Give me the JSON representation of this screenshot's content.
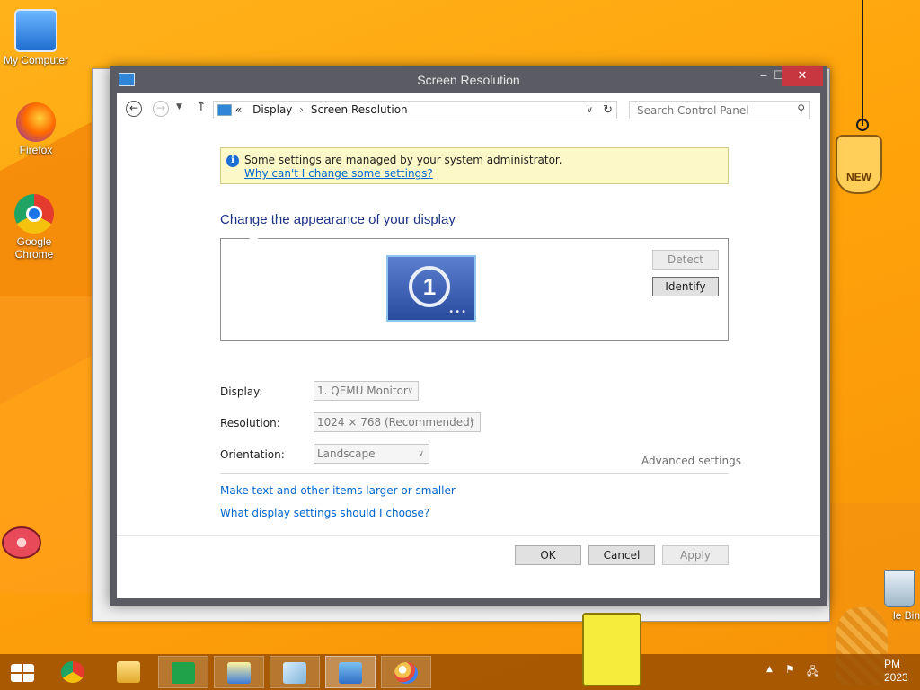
{
  "desktop": {
    "icons": [
      {
        "label": "My Computer"
      },
      {
        "label": "Firefox"
      },
      {
        "label": "Google Chrome"
      },
      {
        "label": "le Bin"
      }
    ],
    "tag_text": "NEW"
  },
  "window": {
    "title": "Screen Resolution",
    "address": {
      "prefix": "«",
      "crumbs": [
        "Display",
        "Screen Resolution"
      ],
      "separator": "›"
    },
    "search": {
      "placeholder": "Search Control Panel"
    },
    "info": {
      "text": "Some settings are managed by your system administrator.",
      "link": "Why can't I change some settings?"
    },
    "heading": "Change the appearance of your display",
    "monitor_number": "1",
    "buttons": {
      "detect": "Detect",
      "identify": "Identify",
      "ok": "OK",
      "cancel": "Cancel",
      "apply": "Apply"
    },
    "fields": {
      "display_label": "Display:",
      "display_value": "1. QEMU Monitor",
      "resolution_label": "Resolution:",
      "resolution_value": "1024 × 768 (Recommended)",
      "orientation_label": "Orientation:",
      "orientation_value": "Landscape"
    },
    "advanced_link": "Advanced settings",
    "links": [
      "Make text and other items larger or smaller",
      "What display settings should I choose?"
    ]
  },
  "taskbar": {
    "clock_time": "PM",
    "clock_date": "2023"
  },
  "colors": {
    "accent_link": "#0066cc",
    "close_button": "#c7373f",
    "heading": "#1e3287",
    "info_bg": "#fdf8c8"
  }
}
